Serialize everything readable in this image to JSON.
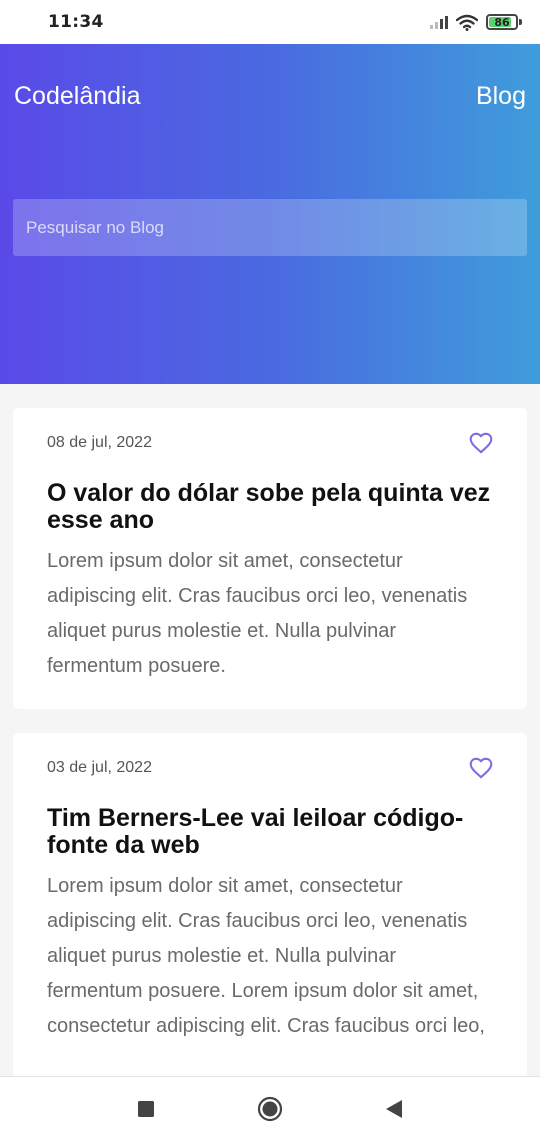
{
  "status_bar": {
    "time": "11:34",
    "battery": "86",
    "battery_level": 0.86,
    "icons": [
      "signal-icon",
      "wifi-icon",
      "battery-icon"
    ]
  },
  "header": {
    "brand": "Codelândia",
    "nav_link": "Blog",
    "search_placeholder": "Pesquisar no Blog"
  },
  "posts": [
    {
      "date": "08 de jul, 2022",
      "title": "O valor do dólar sobe pela quinta vez esse ano",
      "body": "Lorem ipsum dolor sit amet, consectetur adipiscing elit. Cras faucibus orci leo, venenatis aliquet purus molestie et. Nulla pulvinar fermentum posuere.",
      "icon": "heart-icon"
    },
    {
      "date": "03 de jul, 2022",
      "title": "Tim Berners-Lee vai leiloar código-fonte da web",
      "body": "Lorem ipsum dolor sit amet, consectetur adipiscing elit. Cras faucibus orci leo, venenatis aliquet purus molestie et. Nulla pulvinar fermentum posuere. Lorem ipsum dolor sit amet, consectetur adipiscing elit. Cras faucibus orci leo,",
      "icon": "heart-icon"
    }
  ],
  "nav_bar": {
    "buttons": [
      "recent-apps-icon",
      "home-icon",
      "back-icon"
    ]
  },
  "colors": {
    "gradient_start": "#5a4ae8",
    "gradient_end": "#3f9ddb",
    "heart": "#7d6be6",
    "battery_fill": "#59d36c"
  }
}
